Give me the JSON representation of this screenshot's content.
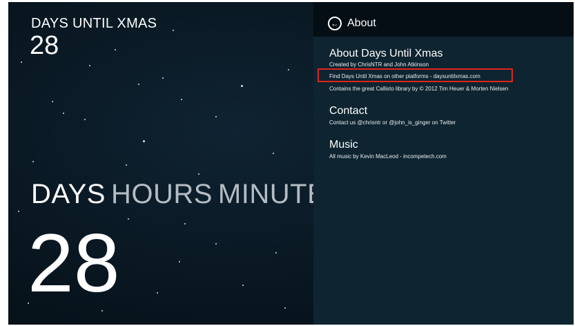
{
  "countdown": {
    "header_label": "DAYS UNTIL XMAS",
    "header_value": "28",
    "units": [
      "DAYS",
      "HOURS",
      "MINUTE"
    ],
    "active_unit": "DAYS",
    "big_value": "28"
  },
  "about_panel": {
    "back_icon": "back-arrow-icon",
    "header_title": "About",
    "sections": [
      {
        "title": "About Days Until Xmas",
        "lines": [
          "Created by ChrisNTR and John Atkinson",
          "Find Days Until Xmas on other platforms - daysuntilxmas.com",
          "Contains the great Callisto library by © 2012 Tim Heuer & Morten Nielsen"
        ]
      },
      {
        "title": "Contact",
        "lines": [
          "Contact us @chrisntr or @john_is_ginger on Twitter"
        ]
      },
      {
        "title": "Music",
        "lines": [
          "All music by Kevin MacLeod - incompetech.com"
        ]
      }
    ]
  },
  "colors": {
    "panel_bg": "#0e2430",
    "header_bg": "#050e14",
    "highlight": "#e0241f"
  }
}
